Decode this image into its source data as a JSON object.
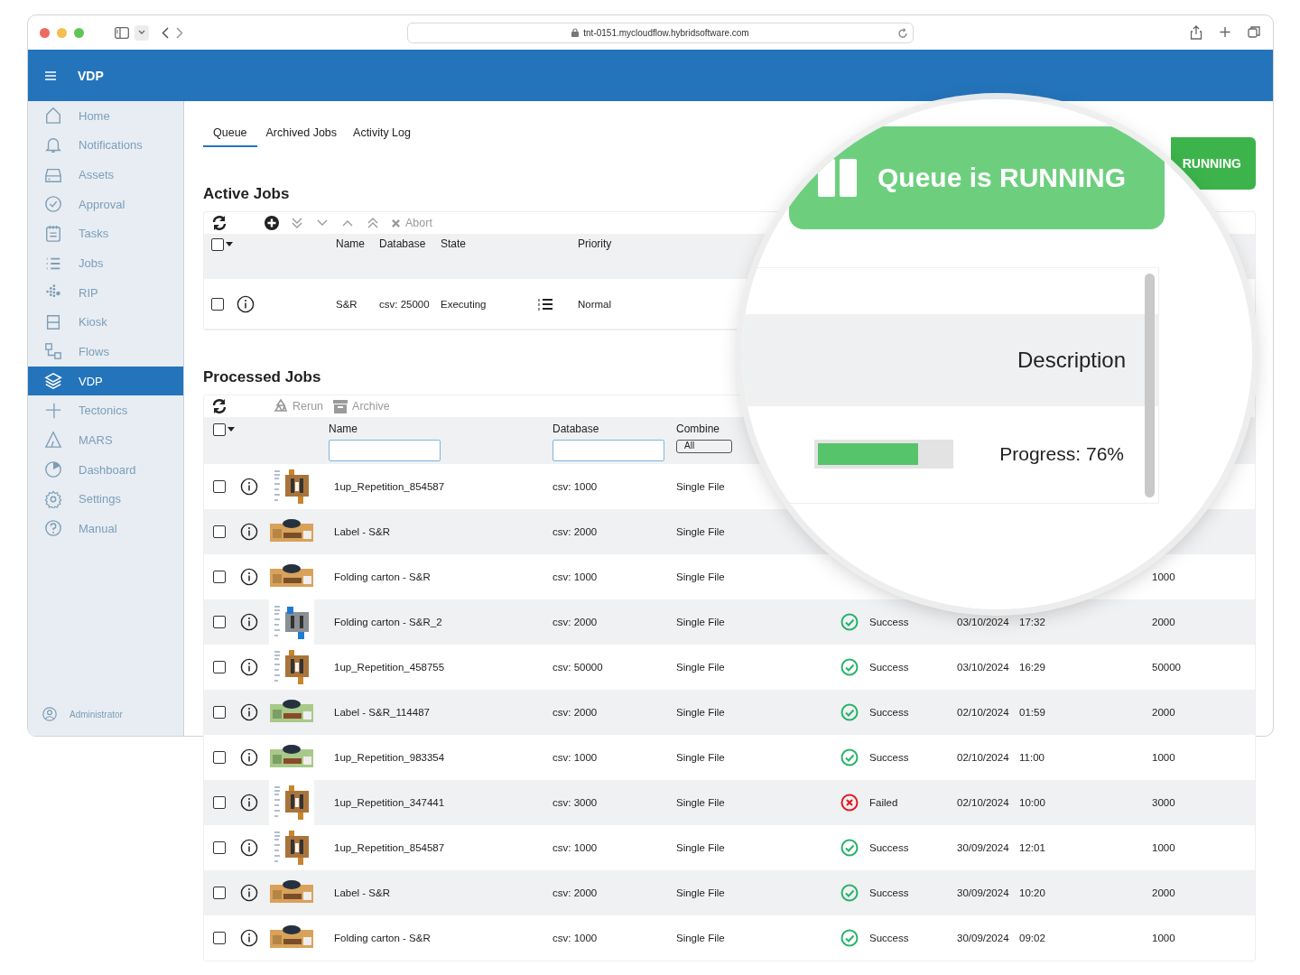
{
  "browser": {
    "url": "tnt-0151.mycloudflow.hybridsoftware.com"
  },
  "app_bar": {
    "title": "VDP"
  },
  "sidebar": {
    "items": [
      {
        "label": "Home",
        "kind": "home",
        "selected": false
      },
      {
        "label": "Notifications",
        "kind": "bell",
        "selected": false
      },
      {
        "label": "Assets",
        "kind": "drive",
        "selected": false
      },
      {
        "label": "Approval",
        "kind": "check",
        "selected": false
      },
      {
        "label": "Tasks",
        "kind": "clipboard",
        "selected": false
      },
      {
        "label": "Jobs",
        "kind": "list",
        "selected": false
      },
      {
        "label": "RIP",
        "kind": "dots",
        "selected": false
      },
      {
        "label": "Kiosk",
        "kind": "tray",
        "selected": false
      },
      {
        "label": "Flows",
        "kind": "nodes",
        "selected": false
      },
      {
        "label": "VDP",
        "kind": "layers",
        "selected": true
      },
      {
        "label": "Tectonics",
        "kind": "cross",
        "selected": false
      },
      {
        "label": "MARS",
        "kind": "triangle",
        "selected": false
      },
      {
        "label": "Dashboard",
        "kind": "pie",
        "selected": false
      },
      {
        "label": "Settings",
        "kind": "gear",
        "selected": false
      },
      {
        "label": "Manual",
        "kind": "help",
        "selected": false
      }
    ],
    "user": "Administrator"
  },
  "tabs": [
    {
      "label": "Queue",
      "selected": true
    },
    {
      "label": "Archived Jobs",
      "selected": false
    },
    {
      "label": "Activity Log",
      "selected": false
    }
  ],
  "status_button": {
    "label": "RUNNING"
  },
  "active_jobs": {
    "title": "Active Jobs",
    "toolbar": [
      {
        "kind": "refresh",
        "disabled": false
      },
      {
        "kind": "add",
        "disabled": false
      },
      {
        "kind": "bottom",
        "disabled": true
      },
      {
        "kind": "down",
        "disabled": true
      },
      {
        "kind": "up",
        "disabled": true
      },
      {
        "kind": "top",
        "disabled": true
      },
      {
        "kind": "abort",
        "label": "Abort",
        "disabled": true
      }
    ],
    "select_all_checked": false,
    "columns": [
      "Name",
      "Database",
      "State",
      "Priority"
    ],
    "rows": [
      {
        "checked": false,
        "name": "S&R",
        "database": "csv: 25000",
        "state": "Executing",
        "priority": "Normal"
      }
    ]
  },
  "processed_jobs": {
    "title": "Processed Jobs",
    "toolbar": [
      {
        "kind": "refresh",
        "disabled": false
      },
      {
        "kind": "rerun",
        "label": "Rerun",
        "disabled": true
      },
      {
        "kind": "archive",
        "label": "Archive",
        "disabled": true
      }
    ],
    "select_all_checked": false,
    "columns": [
      {
        "label": "Name",
        "kind": "text"
      },
      {
        "label": "Database",
        "kind": "text"
      },
      {
        "label": "Combine",
        "kind": "select",
        "value": "All"
      }
    ],
    "rows": [
      {
        "checked": false,
        "kind": "carton",
        "name": "1up_Repetition_854587",
        "database": "csv: 1000",
        "combine": "Single File"
      },
      {
        "checked": false,
        "kind": "label",
        "name": "Label - S&R",
        "database": "csv: 2000",
        "combine": "Single File"
      },
      {
        "checked": false,
        "kind": "label",
        "name": "Folding carton - S&R",
        "database": "csv: 1000",
        "combine": "Single File",
        "count": "1000"
      },
      {
        "checked": false,
        "kind": "carton_blue",
        "name": "Folding carton - S&R_2",
        "database": "csv: 2000",
        "combine": "Single File",
        "status": {
          "kind": "success",
          "text": "Success"
        },
        "date": "03/10/2024",
        "time": "17:32",
        "count": "2000"
      },
      {
        "checked": false,
        "kind": "carton",
        "name": "1up_Repetition_458755",
        "database": "csv: 50000",
        "combine": "Single File",
        "status": {
          "kind": "success",
          "text": "Success"
        },
        "date": "03/10/2024",
        "time": "16:29",
        "count": "50000"
      },
      {
        "checked": false,
        "kind": "label_green",
        "name": "Label - S&R_114487",
        "database": "csv: 2000",
        "combine": "Single File",
        "status": {
          "kind": "success",
          "text": "Success"
        },
        "date": "02/10/2024",
        "time": "01:59",
        "count": "2000"
      },
      {
        "checked": false,
        "kind": "label_green",
        "name": "1up_Repetition_983354",
        "database": "csv: 1000",
        "combine": "Single File",
        "status": {
          "kind": "success",
          "text": "Success"
        },
        "date": "02/10/2024",
        "time": "11:00",
        "count": "1000"
      },
      {
        "checked": false,
        "kind": "carton",
        "name": "1up_Repetition_347441",
        "database": "csv: 3000",
        "combine": "Single File",
        "status": {
          "kind": "failed",
          "text": "Failed"
        },
        "date": "02/10/2024",
        "time": "10:00",
        "count": "3000"
      },
      {
        "checked": false,
        "kind": "carton",
        "name": "1up_Repetition_854587",
        "database": "csv: 1000",
        "combine": "Single File",
        "status": {
          "kind": "success",
          "text": "Success"
        },
        "date": "30/09/2024",
        "time": "12:01",
        "count": "1000"
      },
      {
        "checked": false,
        "kind": "label",
        "name": "Label - S&R",
        "database": "csv: 2000",
        "combine": "Single File",
        "status": {
          "kind": "success",
          "text": "Success"
        },
        "date": "30/09/2024",
        "time": "10:20",
        "count": "2000"
      },
      {
        "checked": false,
        "kind": "label",
        "name": "Folding carton - S&R",
        "database": "csv: 1000",
        "combine": "Single File",
        "status": {
          "kind": "success",
          "text": "Success"
        },
        "date": "30/09/2024",
        "time": "09:02",
        "count": "1000"
      }
    ]
  },
  "magnifier": {
    "banner": "Queue is RUNNING",
    "column": "Description",
    "progress": {
      "level": 0.76,
      "label": "Progress: 76%"
    }
  }
}
